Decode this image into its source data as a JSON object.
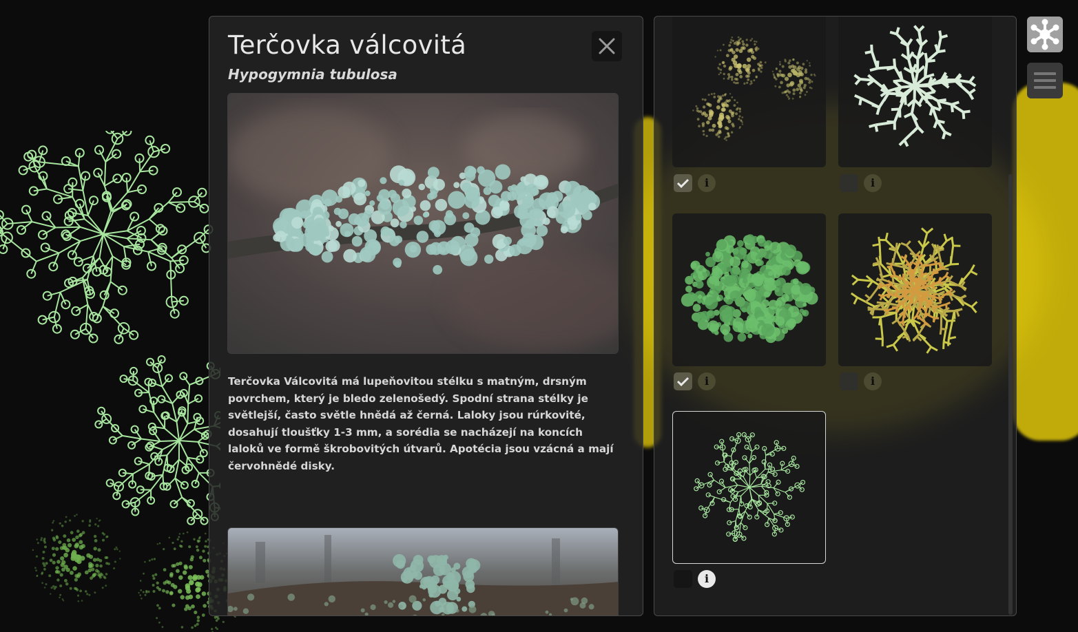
{
  "detail": {
    "title": "Terčovka válcovitá",
    "latin_name": "Hypogymnia tubulosa",
    "description": "Terčovka Válcovitá má lupeňovitou stélku s matným, drsným povrchem, který je bledo zelenošedý. Spodní strana stélky je světlejší, často světle hnědá až černá. Laloky jsou rúrkovité, dosahují tloušťky 1-3 mm, a sorédia se nacházejí na koncích laloků ve formě škrobovitých útvarů. Apotécia jsou vzácná a mají červohnědé disky.",
    "close_icon": "close-icon"
  },
  "gallery": {
    "items": [
      {
        "kind": "dotted-clusters",
        "checked": true,
        "selected": false
      },
      {
        "kind": "pale-branching",
        "checked": false,
        "selected": false
      },
      {
        "kind": "green-blob",
        "checked": true,
        "selected": false
      },
      {
        "kind": "yellow-branching",
        "checked": false,
        "selected": false
      },
      {
        "kind": "outline-branching",
        "checked": false,
        "selected": true
      }
    ],
    "check_icon": "check-icon",
    "info_icon": "info-icon",
    "info_glyph": "i"
  },
  "toolbar": {
    "active_icon": "lichen-icon",
    "menu_icon": "hamburger-menu-icon"
  },
  "colors": {
    "background": "#0c0c0c",
    "panel": "#242424",
    "accent_green": "#a8e6a0",
    "accent_yellow": "#d4c21a"
  }
}
